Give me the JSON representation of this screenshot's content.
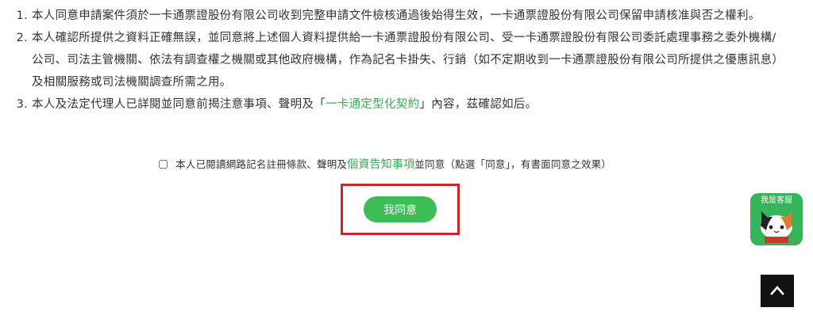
{
  "terms": [
    "本人同意申請案件須於一卡通票證股份有限公司收到完整申請文件檢核通過後始得生效，一卡通票證股份有限公司保留申請核准與否之權利。",
    "本人確認所提供之資料正確無誤，並同意將上述個人資料提供給一卡通票證股份有限公司、受一卡通票證股份有限公司委託處理事務之委外機構/公司、司法主管機關、依法有調查權之機關或其他政府機構，作為記名卡掛失、行銷（如不定期收到一卡通票證股份有限公司所提供之優惠訊息）及相關服務或司法機關調查所需之用。",
    {
      "before": "本人及法定代理人已詳閱並同意前揭注意事項、聲明及「",
      "link": "一卡通定型化契約",
      "after": "」內容，茲確認如后。"
    }
  ],
  "agreement": {
    "before": "本人已閱讀網路記名註冊條款、聲明及",
    "link": "個資告知事項",
    "after": "並同意（點選「同意」，有書面同意之效果）",
    "checked": false
  },
  "agree_button": "我同意",
  "service_widget": {
    "label": "我是客服",
    "icon": "cat-mascot-icon"
  },
  "back_to_top": {
    "icon": "chevron-up-icon"
  },
  "colors": {
    "accent_green": "#3dbd55",
    "link_green": "#3aaa55",
    "highlight_red": "#d0242b",
    "text": "#333333"
  }
}
